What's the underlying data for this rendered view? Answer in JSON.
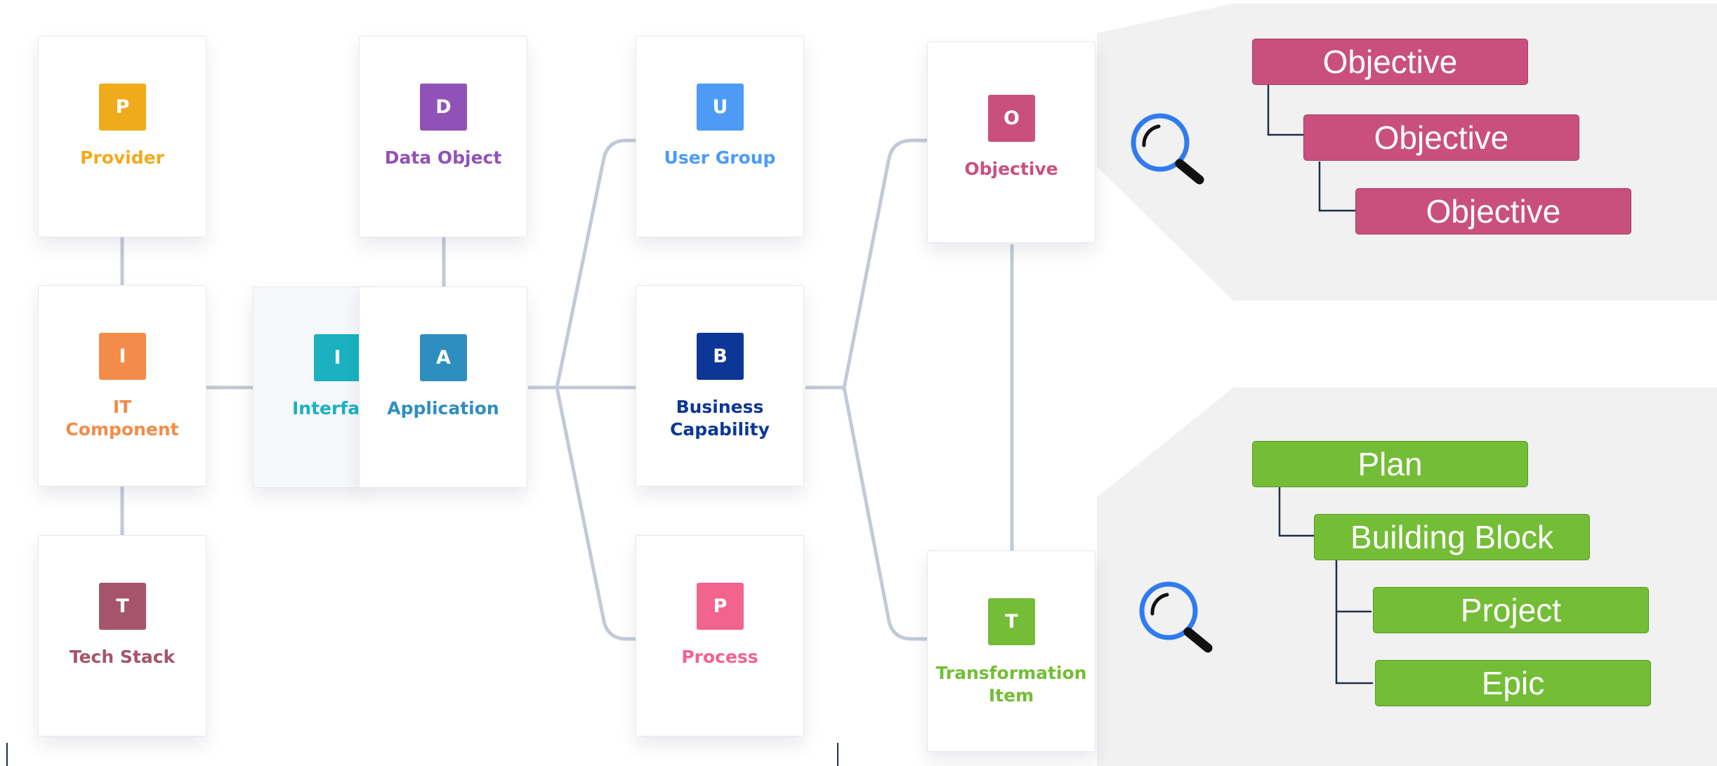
{
  "colors": {
    "connector": "#c2cad9",
    "tree_line": "#1f2d4a",
    "panel_bg": "#f1f1f2",
    "magnifier_ring": "#2f7bef"
  },
  "cards": {
    "provider": {
      "letter": "P",
      "label": "Provider",
      "color": "#f0ab1c"
    },
    "data_object": {
      "letter": "D",
      "label": "Data Object",
      "color": "#9152b8"
    },
    "user_group": {
      "letter": "U",
      "label": "User Group",
      "color": "#4d9bf5"
    },
    "it_component": {
      "letter": "I",
      "label": "IT\nComponent",
      "color": "#f28c48"
    },
    "interface": {
      "letter": "I",
      "label": "Interface",
      "color": "#1ab1c0"
    },
    "application": {
      "letter": "A",
      "label": "Application",
      "color": "#2f8ec0"
    },
    "business_capability": {
      "letter": "B",
      "label": "Business\nCapability",
      "color": "#0d3796"
    },
    "tech_stack": {
      "letter": "T",
      "label": "Tech Stack",
      "color": "#a5546c"
    },
    "process": {
      "letter": "P",
      "label": "Process",
      "color": "#f2638e"
    },
    "objective": {
      "letter": "O",
      "label": "Objective",
      "color": "#c9507d"
    },
    "transformation_item": {
      "letter": "T",
      "label": "Transformation\nItem",
      "color": "#74bd36"
    }
  },
  "objective_hierarchy": {
    "icon": "magnifier-icon",
    "levels": [
      "Objective",
      "Objective",
      "Objective"
    ]
  },
  "transformation_hierarchy": {
    "icon": "magnifier-icon",
    "levels": [
      "Plan",
      "Building Block",
      "Project",
      "Epic"
    ]
  }
}
